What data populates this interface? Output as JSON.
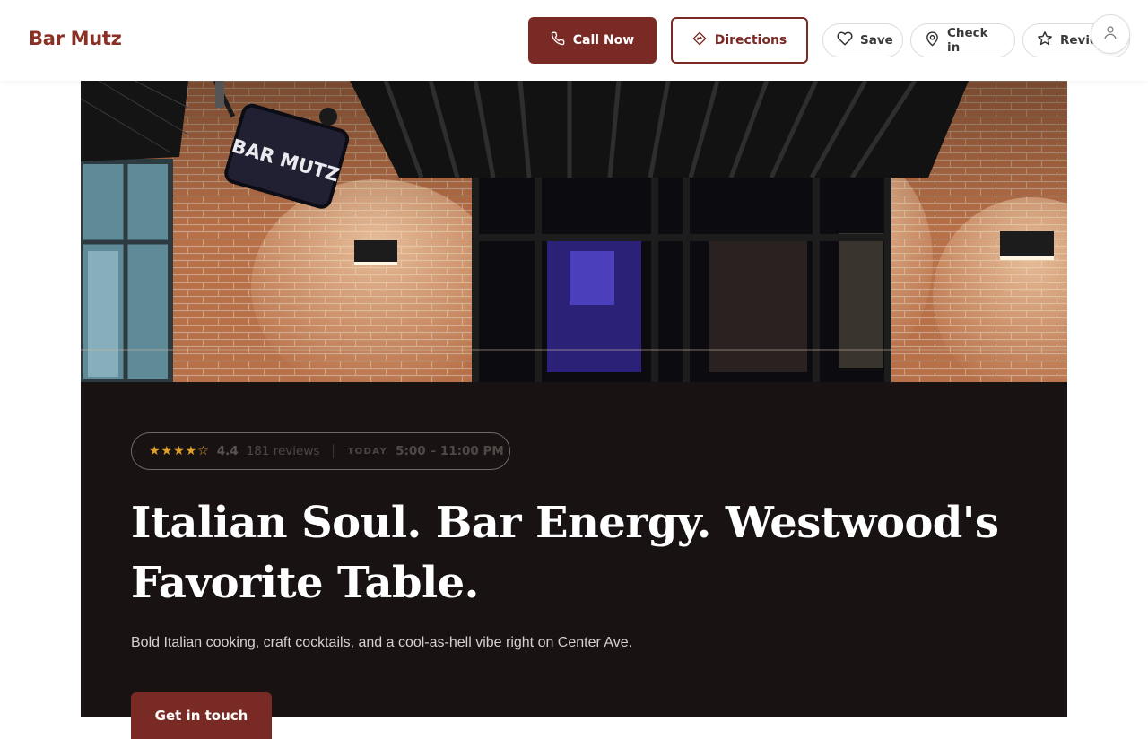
{
  "header": {
    "brand": "Bar Mutz",
    "call_label": "Call Now",
    "directions_label": "Directions",
    "save_label": "Save",
    "checkin_label": "Check in",
    "review_label": "Review"
  },
  "hero": {
    "sign_text": "BAR MUTZ"
  },
  "info": {
    "stars": "★★★★☆",
    "rating_value": 4.4,
    "rating": "4.4",
    "reviews": "181 reviews",
    "today_label": "TODAY",
    "hours": "5:00 – 11:00 PM"
  },
  "headline": "Italian Soul. Bar Energy. Westwood's Favorite Table.",
  "subheadline": "Bold Italian cooking, craft cocktails, and a cool-as-hell vibe right on Center Ave.",
  "cta_label": "Get in touch",
  "colors": {
    "brand": "#8b3026",
    "primary_button": "#7a2a24",
    "dark_panel": "#181312",
    "star": "#e0a126"
  },
  "icons": {
    "call": "phone-icon",
    "directions": "directions-icon",
    "save": "heart-icon",
    "checkin": "map-pin-icon",
    "review": "star-icon",
    "account": "user-icon"
  }
}
